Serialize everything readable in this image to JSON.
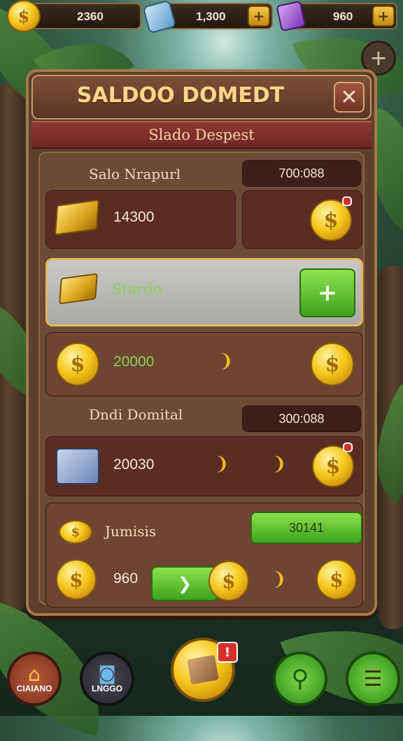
{
  "topbar": {
    "coins": {
      "value": "2360"
    },
    "gems": {
      "value": "1,300",
      "add_label": "+"
    },
    "potions": {
      "value": "960",
      "add_label": "+"
    }
  },
  "side_add_label": "+",
  "dialog": {
    "title": "SALDOO DOMEDT",
    "close_label": "✕",
    "subtitle": "Slado Despest",
    "section1": {
      "label": "Salo Nrapurl",
      "pill": "700:088",
      "amount": "14300"
    },
    "highlight_row": {
      "label": "Stardo",
      "button": "+"
    },
    "reward_row": {
      "amount": "20000"
    },
    "section2": {
      "label": "Dndi Domital",
      "pill": "300:088",
      "amount": "20030"
    },
    "section3": {
      "label": "Jumisis",
      "button": "30141",
      "amount": "960"
    }
  },
  "bottom_nav": {
    "home_label": "CIAIANO",
    "shop_label": "LNGGO",
    "center_badge": "!"
  },
  "colors": {
    "accent_gold": "#f6c81e",
    "panel_brown": "#5d3f2d",
    "header_red": "#8e3a33",
    "button_green": "#3ea21e"
  }
}
